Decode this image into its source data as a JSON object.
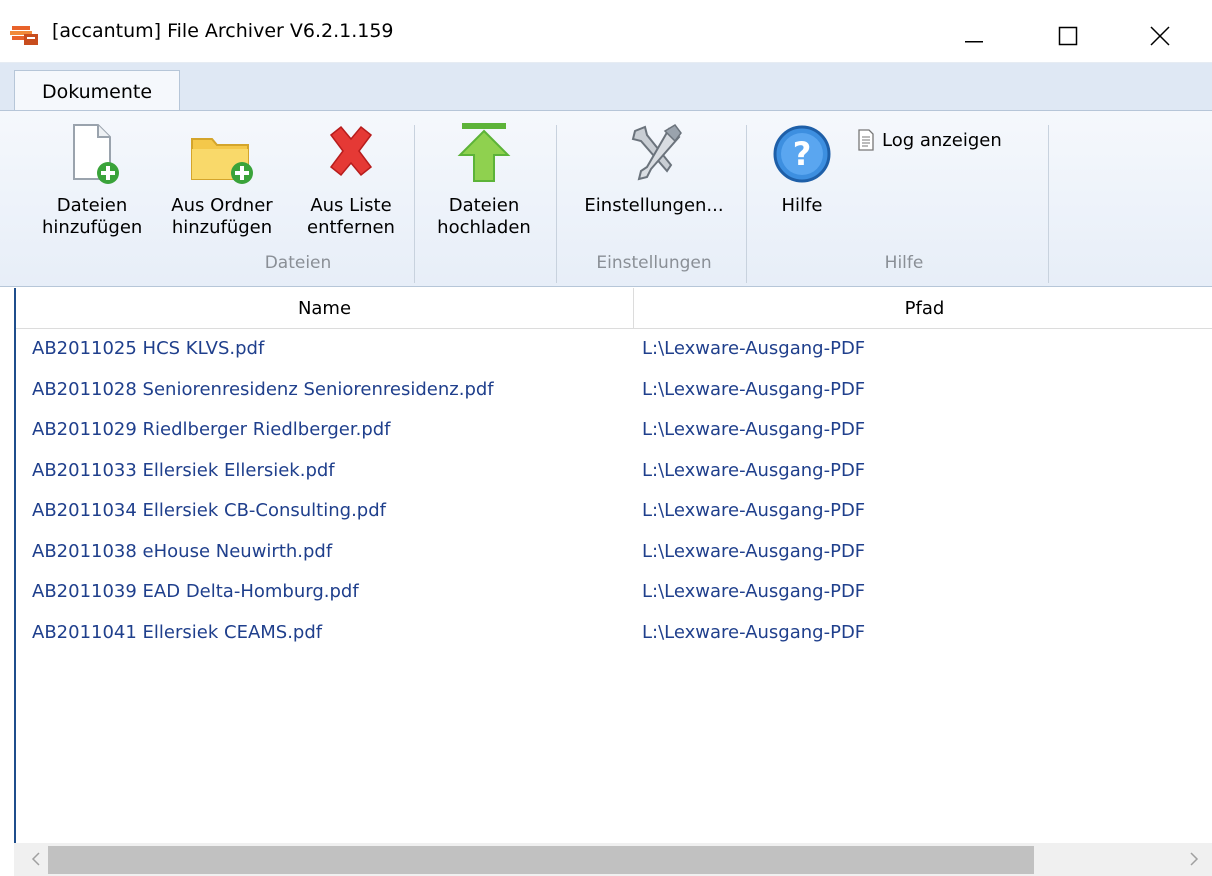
{
  "window": {
    "title": "[accantum] File Archiver V6.2.1.159"
  },
  "tabs": [
    {
      "label": "Dokumente",
      "active": true
    }
  ],
  "ribbon": {
    "buttons": {
      "add_files": "Dateien\nhinzufügen",
      "add_folder": "Aus Ordner\nhinzufügen",
      "remove": "Aus Liste\nentfernen",
      "upload": "Dateien\nhochladen",
      "settings": "Einstellungen...",
      "help": "Hilfe",
      "log": "Log anzeigen"
    },
    "groups": {
      "files": "Dateien",
      "settings": "Einstellungen",
      "help": "Hilfe"
    }
  },
  "table": {
    "columns": [
      "Name",
      "Pfad"
    ],
    "rows": [
      {
        "name": "AB2011025 HCS KLVS.pdf",
        "path": "L:\\Lexware-Ausgang-PDF"
      },
      {
        "name": "AB2011028 Seniorenresidenz Seniorenresidenz.pdf",
        "path": "L:\\Lexware-Ausgang-PDF"
      },
      {
        "name": "AB2011029 Riedlberger Riedlberger.pdf",
        "path": "L:\\Lexware-Ausgang-PDF"
      },
      {
        "name": "AB2011033 Ellersiek Ellersiek.pdf",
        "path": "L:\\Lexware-Ausgang-PDF"
      },
      {
        "name": "AB2011034 Ellersiek CB-Consulting.pdf",
        "path": "L:\\Lexware-Ausgang-PDF"
      },
      {
        "name": "AB2011038 eHouse Neuwirth.pdf",
        "path": "L:\\Lexware-Ausgang-PDF"
      },
      {
        "name": "AB2011039 EAD Delta-Homburg.pdf",
        "path": "L:\\Lexware-Ausgang-PDF"
      },
      {
        "name": "AB2011041 Ellersiek CEAMS.pdf",
        "path": "L:\\Lexware-Ausgang-PDF"
      }
    ]
  },
  "icons": {
    "app": "stack-icon",
    "add_files": "new-document-icon",
    "add_folder": "new-folder-icon",
    "remove": "red-x-icon",
    "upload": "green-up-arrow-icon",
    "settings": "tools-icon",
    "help": "help-icon",
    "log": "document-icon"
  },
  "colors": {
    "link": "#1f3f8c",
    "ribbon_bg": "#e7eef8",
    "tab_bg": "#dfe8f4"
  }
}
